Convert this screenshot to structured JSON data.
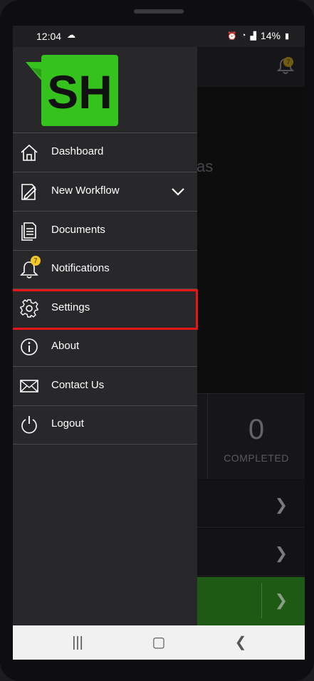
{
  "status_bar": {
    "time": "12:04",
    "battery": "14%"
  },
  "background_screen": {
    "notification_count": "7",
    "partial_title": "as",
    "completed": {
      "count": "0",
      "label": "COMPLETED"
    }
  },
  "drawer": {
    "logo_text": "SH",
    "items": [
      {
        "label": "Dashboard",
        "icon": "home-icon"
      },
      {
        "label": "New Workflow",
        "icon": "edit-document-icon"
      },
      {
        "label": "Documents",
        "icon": "documents-icon"
      },
      {
        "label": "Notifications",
        "icon": "bell-icon",
        "badge": "7"
      },
      {
        "label": "Settings",
        "icon": "gear-icon",
        "highlighted": true
      },
      {
        "label": "About",
        "icon": "info-icon"
      },
      {
        "label": "Contact Us",
        "icon": "mail-icon"
      },
      {
        "label": "Logout",
        "icon": "power-icon"
      }
    ]
  },
  "colors": {
    "brand_green": "#35c21d",
    "highlight_red": "#e41616",
    "badge_yellow": "#f3c623"
  }
}
